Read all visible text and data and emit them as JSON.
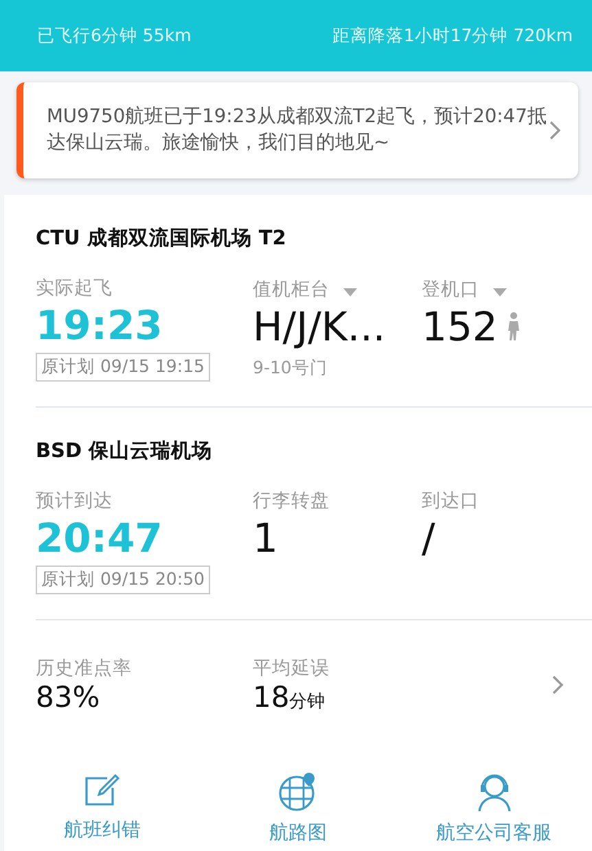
{
  "progress": {
    "flown": "已飞行6分钟 55km",
    "remaining": "距离降落1小时17分钟 720km"
  },
  "notice": {
    "text": "MU9750航班已于19:23从成都双流T2起飞，预计20:47抵达保山云瑞。旅途愉快，我们目的地见~"
  },
  "airports": [
    {
      "title": "CTU 成都双流国际机场 T2",
      "items": [
        {
          "kind": "time",
          "label": "实际起飞",
          "value": "19:23",
          "plan": "原计划 09/15 19:15",
          "dropdown": false
        },
        {
          "kind": "value",
          "label": "值机柜台",
          "value": "H/J/K...",
          "sub": "9-10号门",
          "dropdown": true
        },
        {
          "kind": "gate",
          "label": "登机口",
          "value": "152",
          "dropdown": true
        }
      ]
    },
    {
      "title": "BSD 保山云瑞机场",
      "items": [
        {
          "kind": "time",
          "label": "预计到达",
          "value": "20:47",
          "plan": "原计划 09/15 20:50",
          "dropdown": false
        },
        {
          "kind": "value",
          "label": "行李转盘",
          "value": "1",
          "dropdown": false
        },
        {
          "kind": "value",
          "label": "到达口",
          "value": "/",
          "dropdown": false
        }
      ]
    }
  ],
  "stats": [
    {
      "label": "历史准点率",
      "value": "83%"
    },
    {
      "label": "平均延误",
      "value": "18",
      "unit": "分钟"
    }
  ],
  "nav": [
    {
      "kind": "edit",
      "label": "航班纠错"
    },
    {
      "kind": "globe",
      "label": "航路图"
    },
    {
      "kind": "service",
      "label": "航空公司客服"
    }
  ]
}
